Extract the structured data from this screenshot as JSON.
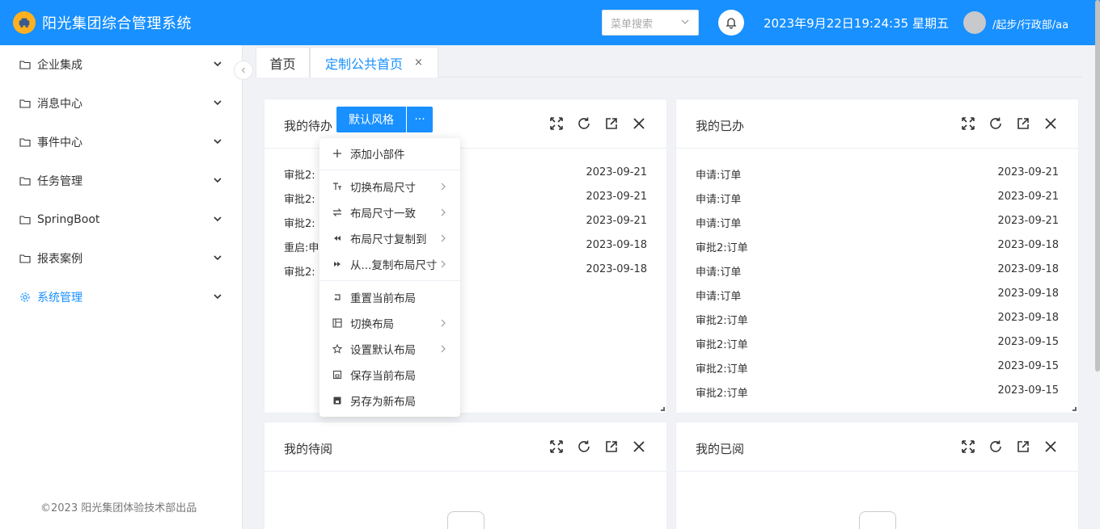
{
  "header": {
    "app_title": "阳光集团综合管理系统",
    "search_placeholder": "菜单搜索",
    "datetime": "2023年9月22日19:24:35 星期五",
    "user": "/起步/行政部/aa",
    "brand_color": "#1890ff"
  },
  "sidebar": {
    "items": [
      {
        "label": "企业集成",
        "icon": "folder-icon"
      },
      {
        "label": "消息中心",
        "icon": "folder-icon"
      },
      {
        "label": "事件中心",
        "icon": "folder-icon"
      },
      {
        "label": "任务管理",
        "icon": "folder-icon"
      },
      {
        "label": "SpringBoot",
        "icon": "folder-icon"
      },
      {
        "label": "报表案例",
        "icon": "folder-icon"
      },
      {
        "label": "系统管理",
        "icon": "gear-icon",
        "active": true
      }
    ],
    "copyright": "©2023 阳光集团体验技术部出品"
  },
  "tabs": [
    {
      "label": "首页"
    },
    {
      "label": "定制公共首页",
      "active": true,
      "close": "×"
    }
  ],
  "cards": {
    "todo": {
      "title": "我的待办",
      "rows": [
        {
          "name": "审批2:",
          "date": "2023-09-21"
        },
        {
          "name": "审批2:",
          "date": "2023-09-21"
        },
        {
          "name": "审批2:",
          "date": "2023-09-21"
        },
        {
          "name": "重启:申",
          "date": "2023-09-18"
        },
        {
          "name": "审批2:",
          "date": "2023-09-18"
        }
      ]
    },
    "done": {
      "title": "我的已办",
      "rows": [
        {
          "name": "申请:订单",
          "date": "2023-09-21"
        },
        {
          "name": "申请:订单",
          "date": "2023-09-21"
        },
        {
          "name": "申请:订单",
          "date": "2023-09-21"
        },
        {
          "name": "审批2:订单",
          "date": "2023-09-18"
        },
        {
          "name": "申请:订单",
          "date": "2023-09-18"
        },
        {
          "name": "申请:订单",
          "date": "2023-09-18"
        },
        {
          "name": "审批2:订单",
          "date": "2023-09-18"
        },
        {
          "name": "审批2:订单",
          "date": "2023-09-15"
        },
        {
          "name": "审批2:订单",
          "date": "2023-09-15"
        },
        {
          "name": "审批2:订单",
          "date": "2023-09-15"
        }
      ]
    },
    "toread": {
      "title": "我的待阅"
    },
    "read": {
      "title": "我的已阅"
    }
  },
  "style_button": {
    "label": "默认风格",
    "more": "···"
  },
  "menu": {
    "items": [
      {
        "label": "添加小部件",
        "icon": "plus-icon"
      },
      {
        "label": "切换布局尺寸",
        "icon": "text-size-icon",
        "submenu": true
      },
      {
        "label": "布局尺寸一致",
        "icon": "swap-icon",
        "submenu": true
      },
      {
        "label": "布局尺寸复制到",
        "icon": "rewind-icon",
        "submenu": true
      },
      {
        "label": "从...复制布局尺寸",
        "icon": "fast-forward-icon",
        "submenu": true
      },
      {
        "label": "重置当前布局",
        "icon": "reset-icon"
      },
      {
        "label": "切换布局",
        "icon": "layout-icon",
        "submenu": true
      },
      {
        "label": "设置默认布局",
        "icon": "star-icon",
        "submenu": true
      },
      {
        "label": "保存当前布局",
        "icon": "save-icon"
      },
      {
        "label": "另存为新布局",
        "icon": "save-as-icon"
      }
    ]
  }
}
